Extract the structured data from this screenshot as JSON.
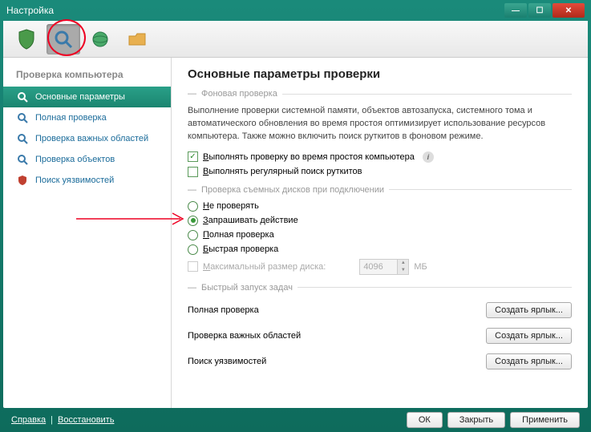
{
  "window": {
    "title": "Настройка"
  },
  "tabs": {
    "items": [
      "shield",
      "search",
      "globe",
      "folder"
    ],
    "active": 1
  },
  "sidebar": {
    "title": "Проверка компьютера",
    "items": [
      {
        "label": "Основные параметры",
        "icon": "search",
        "active": true
      },
      {
        "label": "Полная проверка",
        "icon": "search",
        "active": false
      },
      {
        "label": "Проверка важных областей",
        "icon": "search",
        "active": false
      },
      {
        "label": "Проверка объектов",
        "icon": "search",
        "active": false
      },
      {
        "label": "Поиск уязвимостей",
        "icon": "shield",
        "active": false
      }
    ]
  },
  "main": {
    "heading": "Основные параметры проверки",
    "group_bg": {
      "title": "Фоновая проверка",
      "desc": "Выполнение проверки системной памяти, объектов автозапуска, системного тома и автоматического обновления во время простоя оптимизирует использование ресурсов компьютера. Также можно включить поиск руткитов в фоновом режиме.",
      "cb_idle": {
        "label": "Выполнять проверку во время простоя компьютера",
        "checked": true
      },
      "cb_rootkit": {
        "label": "Выполнять регулярный поиск руткитов",
        "checked": false
      }
    },
    "group_removable": {
      "title": "Проверка съемных дисков при подключении",
      "options": [
        {
          "label": "Не проверять",
          "checked": false
        },
        {
          "label": "Запрашивать действие",
          "checked": true
        },
        {
          "label": "Полная проверка",
          "checked": false
        },
        {
          "label": "Быстрая проверка",
          "checked": false
        }
      ],
      "maxsize": {
        "label": "Максимальный размер диска:",
        "value": "4096",
        "unit": "МБ",
        "enabled": false
      }
    },
    "group_quick": {
      "title": "Быстрый запуск задач",
      "rows": [
        {
          "label": "Полная проверка",
          "button": "Создать ярлык..."
        },
        {
          "label": "Проверка важных областей",
          "button": "Создать ярлык..."
        },
        {
          "label": "Поиск уязвимостей",
          "button": "Создать ярлык..."
        }
      ]
    }
  },
  "footer": {
    "help": "Справка",
    "restore": "Восстановить",
    "ok": "ОК",
    "close": "Закрыть",
    "apply": "Применить"
  }
}
